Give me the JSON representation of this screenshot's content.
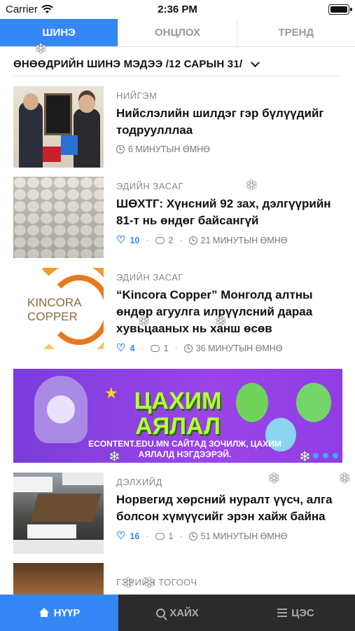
{
  "status_bar": {
    "carrier": "Carrier",
    "time": "2:36 PM"
  },
  "tabs": [
    {
      "label": "ШИНЭ",
      "active": true
    },
    {
      "label": "ОНЦЛОХ",
      "active": false
    },
    {
      "label": "ТРЕНД",
      "active": false
    }
  ],
  "section": {
    "title": "ӨНӨӨДРИЙН ШИНЭ МЭДЭЭ /12 САРЫН 31/"
  },
  "articles": [
    {
      "category": "НИЙГЭМ",
      "headline": "Нийслэлийн шилдэг гэр бүлүүдийг тодруулллаа",
      "time": "6 МИНУТЫН ӨМНӨ"
    },
    {
      "category": "ЭДИЙН ЗАСАГ",
      "headline": "ШӨХТГ: Хүнсний 92 зах, дэлгүүрийн 81-т нь өндөг байсангүй",
      "likes": "10",
      "comments": "2",
      "time": "21 МИНУТЫН ӨМНӨ"
    },
    {
      "category": "ЭДИЙН ЗАСАГ",
      "headline": "“Kincora Copper” Монголд алтны өндөр агуулга илрүүлсний дараа хувьцааных нь ханш өсөв",
      "likes": "4",
      "comments": "1",
      "time": "36 МИНУТЫН ӨМНӨ",
      "thumb_logo": "KINCORA COPPER"
    },
    {
      "category": "ДЭЛХИЙД",
      "headline": "Норвегид хөрсний нуралт үүсч, алга болсон хүмүүсийг эрэн хайж байна",
      "likes": "16",
      "comments": "1",
      "time": "51 МИНУТЫН ӨМНӨ"
    },
    {
      "category": "ГЭРИЙН ТОГООЧ"
    }
  ],
  "banner": {
    "title": "ЦАХИМ АЯЛАЛ",
    "subtitle": "ECONTENT.EDU.MN САЙТАД ЗОЧИЛЖ, ЦАХИМ АЯЛАЛД НЭГДЭЭРЭЙ."
  },
  "bottom_nav": [
    {
      "label": "НҮҮР",
      "icon": "home-icon",
      "active": true
    },
    {
      "label": "ХАЙХ",
      "icon": "search-icon",
      "active": false
    },
    {
      "label": "ЦЭС",
      "icon": "menu-icon",
      "active": false
    }
  ],
  "colors": {
    "accent": "#3487f4",
    "bottom_bar": "#2b2b2b"
  }
}
